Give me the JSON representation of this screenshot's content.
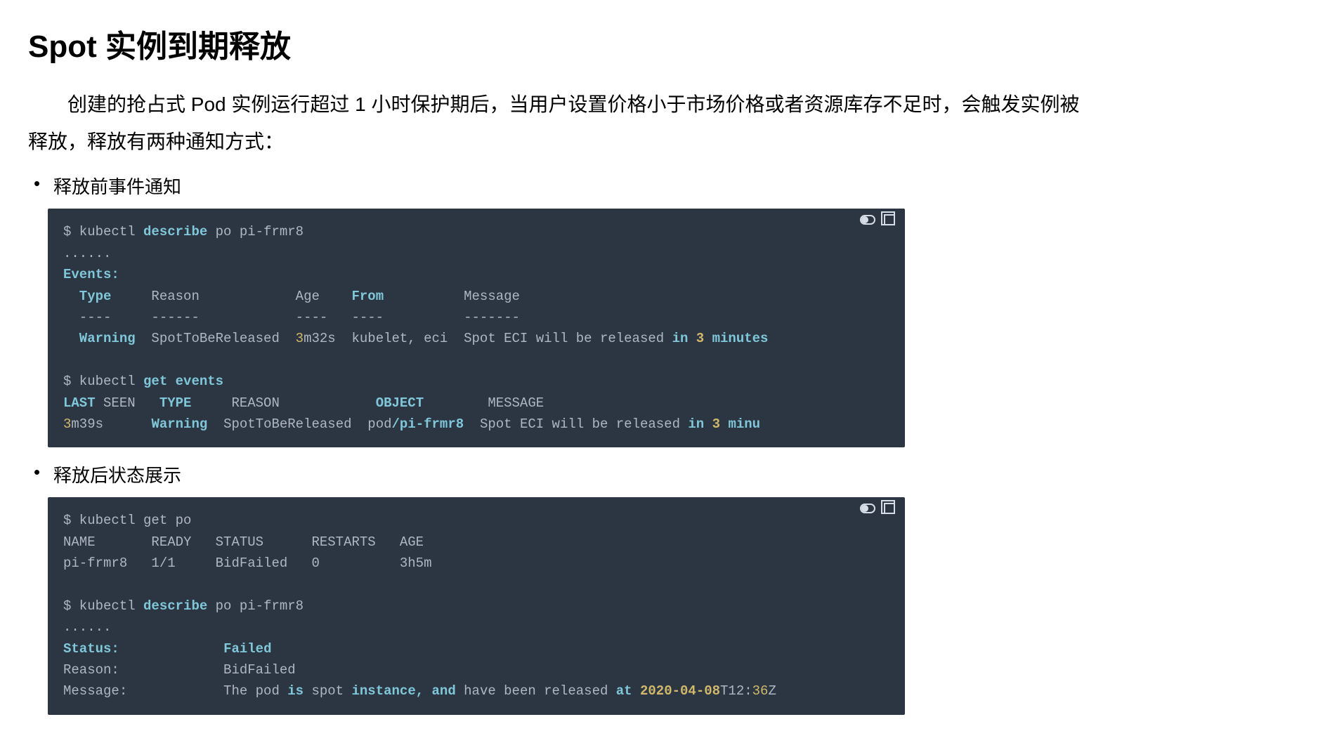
{
  "heading": "Spot 实例到期释放",
  "intro": "创建的抢占式 Pod 实例运行超过 1 小时保护期后，当用户设置价格小于市场价格或者资源库存不足时，会触发实例被释放，释放有两种通知方式：",
  "bullets": [
    "释放前事件通知",
    "释放后状态展示"
  ],
  "code1": {
    "l1a": "$ kubectl ",
    "l1b": "describe",
    "l1c": " po pi-frmr8",
    "l2": "......",
    "l3": "Events:",
    "l4a": "  Type",
    "l4b": "     Reason            Age    ",
    "l4c": "From",
    "l4d": "          Message",
    "l5": "  ----     ------            ----   ----          -------",
    "l6a": "  Warning",
    "l6b": "  SpotToBeReleased  ",
    "l6c": "3",
    "l6d": "m32s  kubelet, eci  Spot ECI will be released ",
    "l6e": "in ",
    "l6f": "3 ",
    "l6g": "minutes",
    "l7": " ",
    "l8a": "$ kubectl ",
    "l8b": "get events",
    "l9a": "LAST",
    "l9b": " SEEN   ",
    "l9c": "TYPE",
    "l9d": "     REASON            ",
    "l9e": "OBJECT",
    "l9f": "        MESSAGE",
    "l10a": "3",
    "l10b": "m39s      ",
    "l10c": "Warning",
    "l10d": "  SpotToBeReleased  pod",
    "l10e": "/pi-frmr8",
    "l10f": "  Spot ECI will be released ",
    "l10g": "in ",
    "l10h": "3 ",
    "l10i": "minu"
  },
  "code2": {
    "l1": "$ kubectl get po",
    "l2": "NAME       READY   STATUS      RESTARTS   AGE",
    "l3": "pi-frmr8   1/1     BidFailed   0          3h5m",
    "l4": " ",
    "l5a": "$ kubectl ",
    "l5b": "describe",
    "l5c": " po pi-frmr8",
    "l6": "......",
    "l7a": "Status:",
    "l7b": "             ",
    "l7c": "Failed",
    "l8": "Reason:             BidFailed",
    "l9a": "Message:            The pod ",
    "l9b": "is",
    "l9c": " spot ",
    "l9d": "instance, and",
    "l9e": " have been released ",
    "l9f": "at ",
    "l9g": "2020-04-08",
    "l9h": "T12:",
    "l9i": "36",
    "l9j": "Z"
  }
}
